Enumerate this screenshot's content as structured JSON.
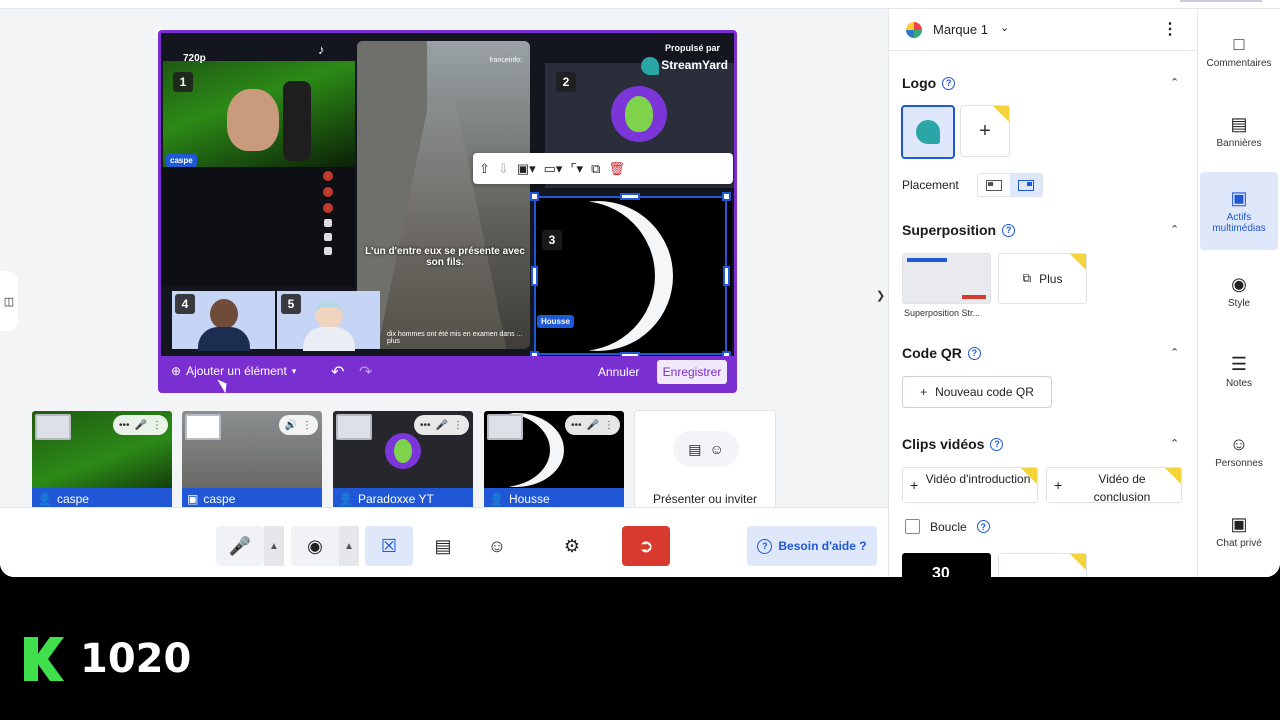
{
  "canvas": {
    "resolution": "720p",
    "propulse_par": "Propulsé par",
    "brand_logo": "StreamYard",
    "caption": "L'un d'entre eux se présente avec son fils.",
    "brand_source": "franceinfo:",
    "footer_text": "dix hommes ont été mis en examen dans ... plus",
    "slots": [
      {
        "number": "1",
        "name": "caspe"
      },
      {
        "number": "2"
      },
      {
        "number": "3",
        "name": "Housse"
      },
      {
        "number": "4"
      },
      {
        "number": "5"
      }
    ]
  },
  "canvas_bar": {
    "add_element": "Ajouter un élément",
    "cancel": "Annuler",
    "save": "Enregistrer"
  },
  "backstage": [
    {
      "name": "caspe",
      "type": "person"
    },
    {
      "name": "caspe",
      "type": "screen"
    },
    {
      "name": "Paradoxxe YT",
      "type": "person"
    },
    {
      "name": "Housse",
      "type": "person"
    }
  ],
  "invite_label": "Présenter ou inviter",
  "help_button": "Besoin d'aide ?",
  "panel": {
    "brand": "Marque 1",
    "logo_title": "Logo",
    "placement_label": "Placement",
    "overlay_title": "Superposition",
    "overlay_caption": "Superposition Str...",
    "more_label": "Plus",
    "qr_title": "Code QR",
    "qr_button": "Nouveau code QR",
    "clips_title": "Clips vidéos",
    "intro_clip": "Vidéo d'introduction",
    "outro_clip": "Vidéo de conclusion",
    "loop_label": "Boucle",
    "countdown": "30"
  },
  "rail": [
    {
      "label": "Commentaires",
      "icon": "comment-icon"
    },
    {
      "label": "Bannières",
      "icon": "banner-icon"
    },
    {
      "label": "Actifs multimédias",
      "icon": "media-icon",
      "active": true
    },
    {
      "label": "Style",
      "icon": "palette-icon"
    },
    {
      "label": "Notes",
      "icon": "notes-icon"
    },
    {
      "label": "Personnes",
      "icon": "people-icon"
    },
    {
      "label": "Chat privé",
      "icon": "chat-icon"
    }
  ],
  "watermark": {
    "counter": "1020"
  },
  "colors": {
    "accent": "#7a2fd0",
    "primary": "#1f57d6",
    "leave": "#d93a2e",
    "watermark": "#3fe04b"
  }
}
